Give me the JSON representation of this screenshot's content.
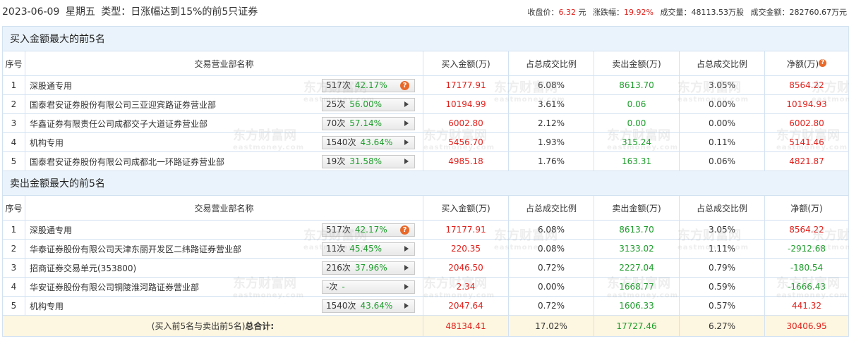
{
  "header": {
    "date": "2023-06-09",
    "weekday": "星期五",
    "type_label": "类型：",
    "type_value": "日涨幅达到15%的前5只证券",
    "close_label": "收盘价：",
    "close_value": "6.32",
    "close_unit": "元",
    "change_label": "涨跌幅：",
    "change_value": "19.92%",
    "volume_label": "成交量：",
    "volume_value": "48113.53万股",
    "amount_label": "成交金额：",
    "amount_value": "282760.67万元"
  },
  "columns": {
    "idx": "序号",
    "name": "交易营业部名称",
    "buy": "买入金额(万)",
    "buy_ratio": "占总成交比例",
    "sell": "卖出金额(万)",
    "sell_ratio": "占总成交比例",
    "net": "净额(万)",
    "net_alt": "净额(万)"
  },
  "buy_section": {
    "title": "买入金额最大的前5名",
    "rows": [
      {
        "idx": "1",
        "name": "深股通专用",
        "count": "517次",
        "pct": "42.17%",
        "icon": "question",
        "buy": "17177.91",
        "buy_ratio": "6.08%",
        "sell": "8613.70",
        "sell_ratio": "3.05%",
        "net": "8564.22"
      },
      {
        "idx": "2",
        "name": "国泰君安证券股份有限公司三亚迎宾路证券营业部",
        "count": "25次",
        "pct": "56.00%",
        "icon": "arrow",
        "buy": "10194.99",
        "buy_ratio": "3.61%",
        "sell": "0.06",
        "sell_ratio": "0.00%",
        "net": "10194.93"
      },
      {
        "idx": "3",
        "name": "华鑫证券有限责任公司成都交子大道证券营业部",
        "count": "70次",
        "pct": "57.14%",
        "icon": "arrow",
        "buy": "6002.80",
        "buy_ratio": "2.12%",
        "sell": "0.00",
        "sell_ratio": "0.00%",
        "net": "6002.80"
      },
      {
        "idx": "4",
        "name": "机构专用",
        "count": "1540次",
        "pct": "43.64%",
        "icon": "arrow",
        "buy": "5456.70",
        "buy_ratio": "1.93%",
        "sell": "315.24",
        "sell_ratio": "0.11%",
        "net": "5141.46"
      },
      {
        "idx": "5",
        "name": "国泰君安证券股份有限公司成都北一环路证券营业部",
        "count": "19次",
        "pct": "31.58%",
        "icon": "arrow",
        "buy": "4985.18",
        "buy_ratio": "1.76%",
        "sell": "163.31",
        "sell_ratio": "0.06%",
        "net": "4821.87"
      }
    ]
  },
  "sell_section": {
    "title": "卖出金额最大的前5名",
    "rows": [
      {
        "idx": "1",
        "name": "深股通专用",
        "count": "517次",
        "pct": "42.17%",
        "icon": "question",
        "buy": "17177.91",
        "buy_ratio": "6.08%",
        "sell": "8613.70",
        "sell_ratio": "3.05%",
        "net": "8564.22"
      },
      {
        "idx": "2",
        "name": "华泰证券股份有限公司天津东丽开发区二纬路证券营业部",
        "count": "11次",
        "pct": "45.45%",
        "icon": "arrow",
        "buy": "220.35",
        "buy_ratio": "0.08%",
        "sell": "3133.02",
        "sell_ratio": "1.11%",
        "net": "-2912.68"
      },
      {
        "idx": "3",
        "name": "招商证券交易单元(353800)",
        "count": "216次",
        "pct": "37.96%",
        "icon": "arrow",
        "buy": "2046.50",
        "buy_ratio": "0.72%",
        "sell": "2227.04",
        "sell_ratio": "0.79%",
        "net": "-180.54"
      },
      {
        "idx": "4",
        "name": "华安证券股份有限公司铜陵淮河路证券营业部",
        "count": "-次",
        "pct": "-",
        "icon": "arrow",
        "buy": "2.34",
        "buy_ratio": "0.00%",
        "sell": "1668.77",
        "sell_ratio": "0.59%",
        "net": "-1666.43"
      },
      {
        "idx": "5",
        "name": "机构专用",
        "count": "1540次",
        "pct": "43.64%",
        "icon": "arrow",
        "buy": "2047.64",
        "buy_ratio": "0.72%",
        "sell": "1606.33",
        "sell_ratio": "0.57%",
        "net": "441.32"
      }
    ]
  },
  "total": {
    "label": "(买入前5名与卖出前5名)",
    "label_bold": "总合计:",
    "buy": "48134.41",
    "buy_ratio": "17.02%",
    "sell": "17727.46",
    "sell_ratio": "6.27%",
    "net": "30406.95"
  },
  "watermark": {
    "cn": "东方财富网",
    "en": "eastmoney.com"
  },
  "colors": {
    "accent_red": "#e0201b",
    "accent_green": "#1e9d2c",
    "section_bg": "#eaf3fb",
    "total_bg": "#fdf6e0",
    "border": "#d3e2f1",
    "badge_icon": "#e8692a"
  }
}
